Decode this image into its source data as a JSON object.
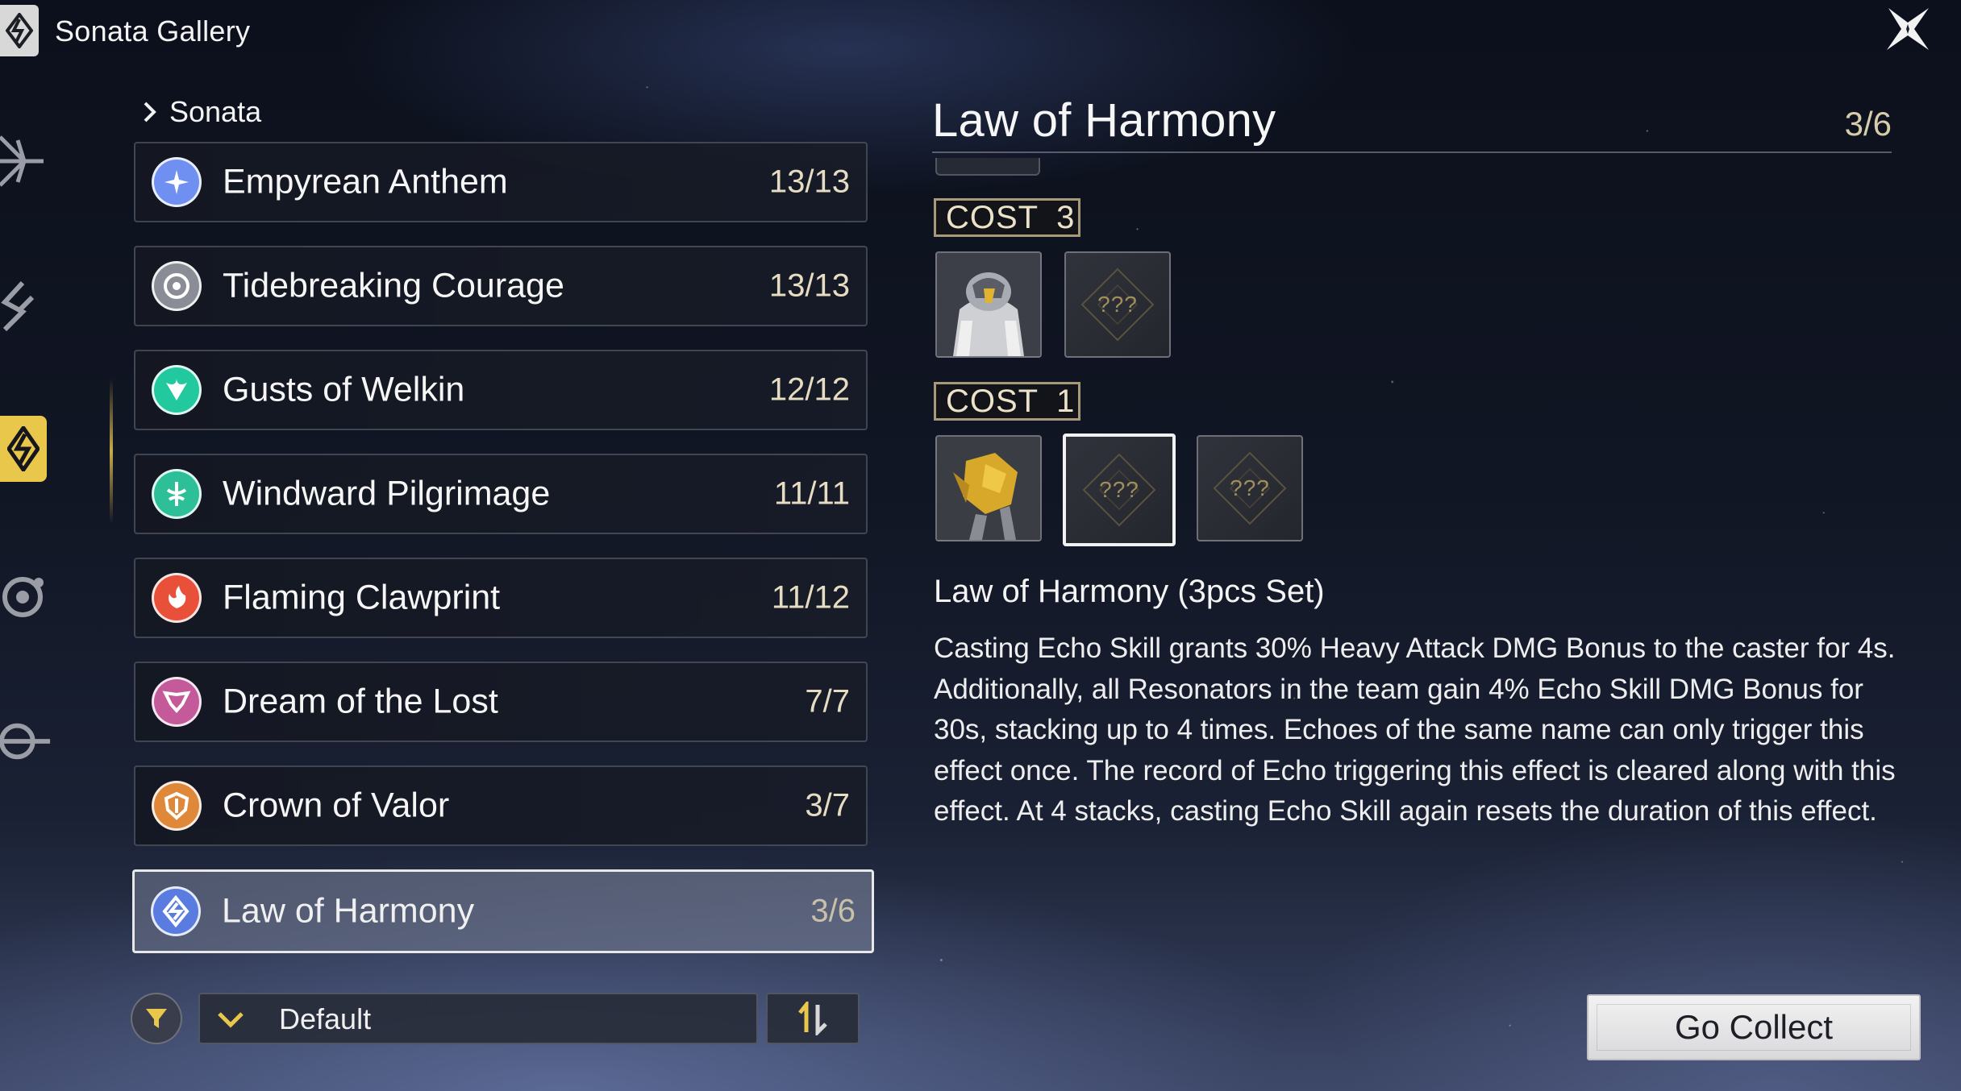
{
  "header": {
    "title": "Sonata Gallery",
    "logo_icon": "sonata-diamond-icon",
    "close_icon": "close-star-icon"
  },
  "side_rail": {
    "items": [
      {
        "icon": "compass-star-icon",
        "active": false
      },
      {
        "icon": "wave-chevron-icon",
        "active": false
      },
      {
        "icon": "sonata-diamond-icon",
        "active": true
      },
      {
        "icon": "gear-flower-icon",
        "active": false
      },
      {
        "icon": "orbit-eye-icon",
        "active": false
      }
    ],
    "accent": "#e9c74a"
  },
  "list": {
    "category": "Sonata",
    "items": [
      {
        "name": "Empyrean Anthem",
        "count": "13/13",
        "icon_color": "#7aa0ff",
        "selected": false
      },
      {
        "name": "Tidebreaking Courage",
        "count": "13/13",
        "icon_color": "#c8c8d0",
        "selected": false
      },
      {
        "name": "Gusts of Welkin",
        "count": "12/12",
        "icon_color": "#3fe0b8",
        "selected": false
      },
      {
        "name": "Windward Pilgrimage",
        "count": "11/11",
        "icon_color": "#49d4b0",
        "selected": false
      },
      {
        "name": "Flaming Clawprint",
        "count": "11/12",
        "icon_color": "#ff6a4a",
        "selected": false
      },
      {
        "name": "Dream of the Lost",
        "count": "7/7",
        "icon_color": "#e07ab8",
        "selected": false
      },
      {
        "name": "Crown of Valor",
        "count": "3/7",
        "icon_color": "#f0a050",
        "selected": false
      },
      {
        "name": "Law of Harmony",
        "count": "3/6",
        "icon_color": "#6a8cf0",
        "selected": true
      }
    ]
  },
  "filter": {
    "filter_icon": "funnel-icon",
    "sort_label": "Default",
    "order_icon": "sort-order-icon"
  },
  "detail": {
    "title": "Law of Harmony",
    "count": "3/6",
    "cost_groups": [
      {
        "label": "COST",
        "value": "3",
        "slots": [
          {
            "state": "owned",
            "echo": "armored-knight-echo"
          },
          {
            "state": "locked",
            "text": "???"
          }
        ]
      },
      {
        "label": "COST",
        "value": "1",
        "slots": [
          {
            "state": "owned",
            "echo": "golden-hound-echo"
          },
          {
            "state": "locked",
            "text": "???",
            "selected": true
          },
          {
            "state": "locked",
            "text": "???"
          }
        ]
      }
    ],
    "effect_title": "Law of Harmony (3pcs Set)",
    "effect_lines": [
      "Casting Echo Skill grants 30% Heavy Attack DMG Bonus to the caster for 4s.",
      "Additionally, all Resonators in the team gain 4% Echo Skill DMG Bonus for 30s, stacking up to 4 times. Echoes of the same name can only trigger this effect once. The record of Echo triggering this effect is cleared along with this effect. At 4 stacks, casting Echo Skill again resets the duration of this effect."
    ],
    "go_collect_label": "Go Collect"
  }
}
